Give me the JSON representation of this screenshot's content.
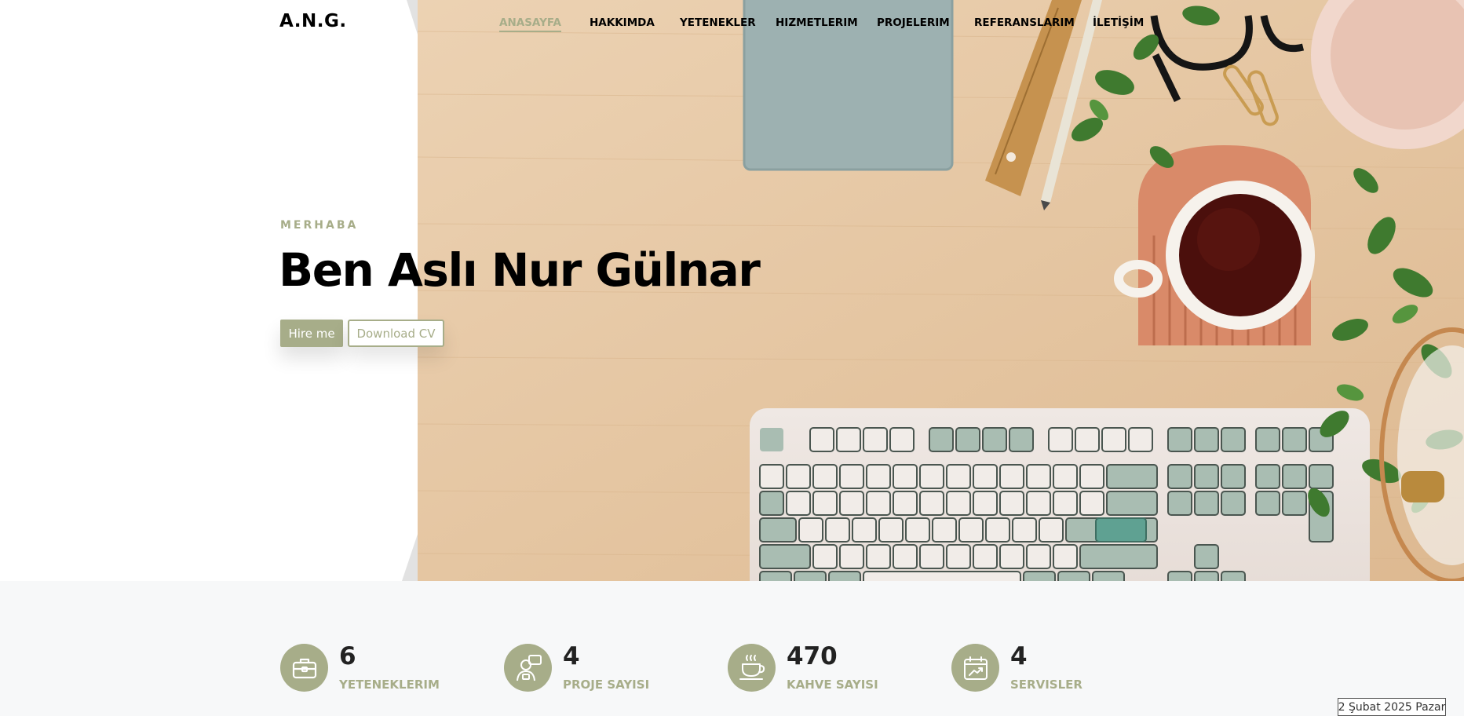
{
  "brand": {
    "logo": "A.N.G."
  },
  "nav": {
    "items": [
      {
        "label": "ANASAYFA",
        "active": true
      },
      {
        "label": "HAKKIMDA",
        "active": false
      },
      {
        "label": "YETENEKLER",
        "active": false
      },
      {
        "label": "HIZMETLERIM",
        "active": false
      },
      {
        "label": "PROJELERIM",
        "active": false
      },
      {
        "label": "REFERANSLARIM",
        "active": false
      },
      {
        "label": "İLETİŞİM",
        "active": false
      }
    ]
  },
  "hero": {
    "greeting": "MERHABA",
    "title": "Ben Aslı Nur Gülnar",
    "hire_label": "Hire me",
    "cv_label": "Download CV"
  },
  "stats": [
    {
      "value": "6",
      "label": "YETENEKLERIM",
      "icon": "briefcase-icon"
    },
    {
      "value": "4",
      "label": "PROJE SAYISI",
      "icon": "developer-icon"
    },
    {
      "value": "470",
      "label": "KAHVE SAYISI",
      "icon": "coffee-icon"
    },
    {
      "value": "4",
      "label": "SERVISLER",
      "icon": "calendar-growth-icon"
    }
  ],
  "date_label": "2 Şubat 2025 Pazar",
  "colors": {
    "accent": "#a7ad89",
    "text": "#000000",
    "stats_bg": "#f7f8f9"
  }
}
